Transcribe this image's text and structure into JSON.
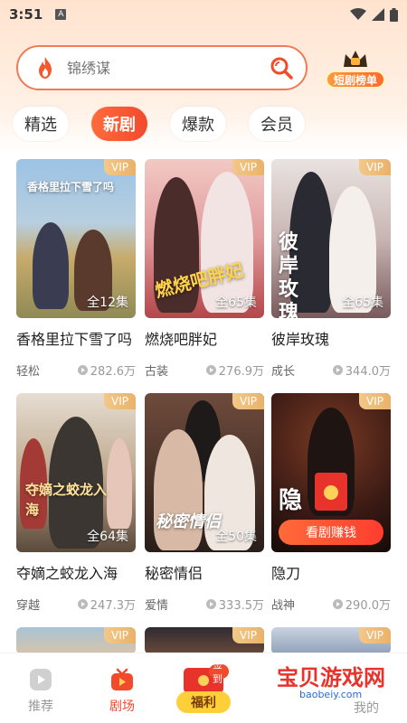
{
  "status_bar": {
    "time": "3:51",
    "sim_letter": "A"
  },
  "search": {
    "placeholder": "锦绣谋"
  },
  "rank_badge": {
    "label": "短剧榜单"
  },
  "tabs": [
    {
      "label": "精选",
      "active": false
    },
    {
      "label": "新剧",
      "active": true
    },
    {
      "label": "爆款",
      "active": false
    },
    {
      "label": "会员",
      "active": false
    }
  ],
  "cards": [
    {
      "title": "香格里拉下雪了吗",
      "genre": "轻松",
      "views": "282.6万",
      "episodes": "全12集",
      "vip": "VIP",
      "poster_text": "香格里拉下雪了吗",
      "colors": [
        "#8fb6d8",
        "#c9b27a"
      ]
    },
    {
      "title": "燃烧吧胖妃",
      "genre": "古装",
      "views": "276.9万",
      "episodes": "全65集",
      "vip": "VIP",
      "poster_text": "燃烧吧胖妃",
      "colors": [
        "#e9a7a9",
        "#c65c5c"
      ]
    },
    {
      "title": "彼岸玫瑰",
      "genre": "成长",
      "views": "344.0万",
      "episodes": "全65集",
      "vip": "VIP",
      "poster_text": "彼岸玫瑰",
      "colors": [
        "#d9d2cf",
        "#8f6f72"
      ]
    },
    {
      "title": "夺嫡之蛟龙入海",
      "genre": "穿越",
      "views": "247.3万",
      "episodes": "全64集",
      "vip": "VIP",
      "poster_text": "夺嫡之蛟龙入海",
      "colors": [
        "#d8cdbd",
        "#6a5b4b"
      ]
    },
    {
      "title": "秘密情侣",
      "genre": "爱情",
      "views": "333.5万",
      "episodes": "全50集",
      "vip": "VIP",
      "poster_text": "秘密情侣",
      "colors": [
        "#6b4a3d",
        "#2d2220"
      ]
    },
    {
      "title": "隐刀",
      "genre": "战神",
      "views": "290.0万",
      "episodes": "",
      "vip": "VIP",
      "poster_text": "隐",
      "colors": [
        "#5a2419",
        "#1a0f0d"
      ],
      "watch_earn": "看剧赚钱"
    }
  ],
  "bottom_nav": {
    "recommend": "推荐",
    "theater": "剧场",
    "welfare": "福利",
    "welfare_sign": "签到",
    "mine": "我的"
  },
  "watermark": {
    "main": "宝贝游戏网",
    "sub": "baobeiy.com"
  },
  "colors": {
    "accent": "#f24a2c",
    "vip": "#e9b26a"
  }
}
